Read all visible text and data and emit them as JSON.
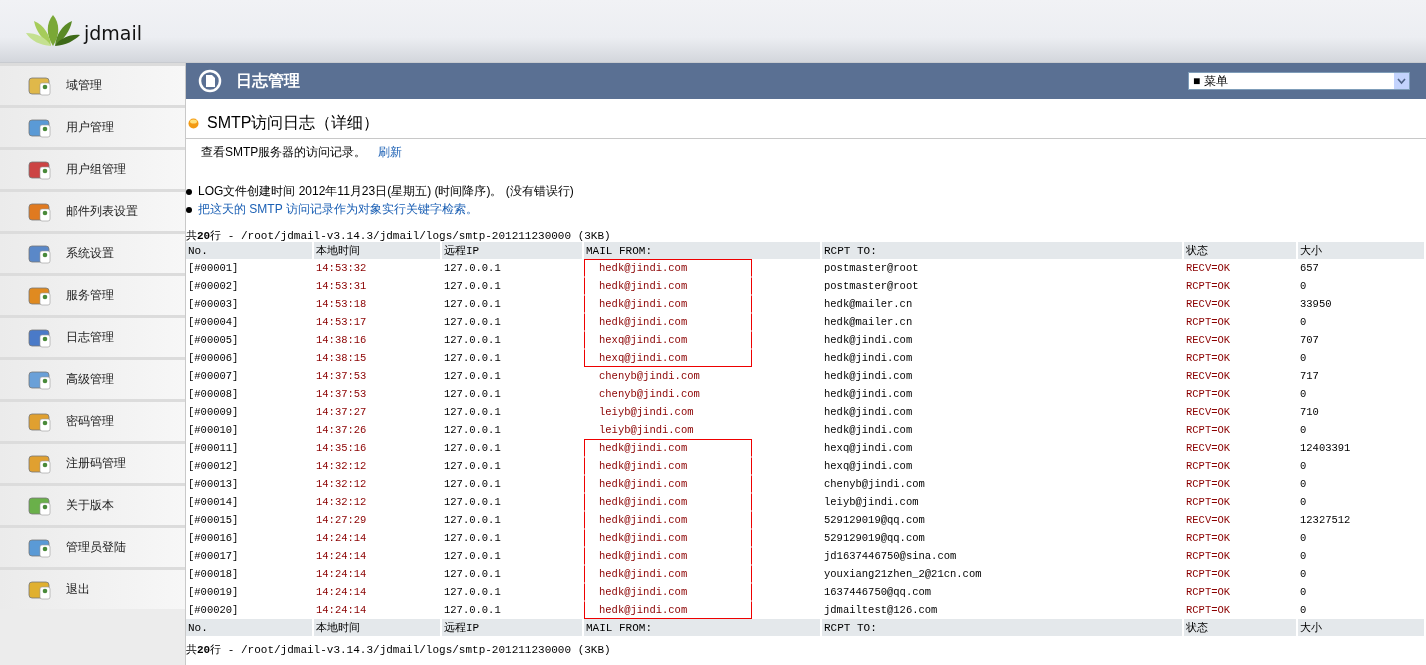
{
  "brand": {
    "name": "jdmail"
  },
  "sidebar": {
    "items": [
      {
        "label": "域管理"
      },
      {
        "label": "用户管理"
      },
      {
        "label": "用户组管理"
      },
      {
        "label": "邮件列表设置"
      },
      {
        "label": "系统设置"
      },
      {
        "label": "服务管理"
      },
      {
        "label": "日志管理"
      },
      {
        "label": "高级管理"
      },
      {
        "label": "密码管理"
      },
      {
        "label": "注册码管理"
      },
      {
        "label": "关于版本"
      },
      {
        "label": "管理员登陆"
      },
      {
        "label": "退出"
      }
    ]
  },
  "title_bar": {
    "title": "日志管理",
    "menu_select": "■ 菜单"
  },
  "section": {
    "title": "SMTP访问日志（详细）",
    "description": "查看SMTP服务器的访问记录。",
    "refresh_link": "刷新",
    "bullets": [
      {
        "kind": "text",
        "text": "LOG文件创建时间 2012年11月23日(星期五) (时间降序)。 (没有错误行)"
      },
      {
        "kind": "link",
        "text": "把这天的 SMTP 访问记录作为对象实行关键字检索。"
      }
    ]
  },
  "summary_top": "共**20**行 - /root/jdmail-v3.14.3/jdmail/logs/smtp-201211230000 (3KB)",
  "table": {
    "columns": [
      "No.",
      "本地时间",
      "远程IP",
      "MAIL FROM:",
      "RCPT TO:",
      "状态",
      "大小"
    ],
    "rows": [
      {
        "no": "[#00001]",
        "time": "14:53:32",
        "ip": "127.0.0.1",
        "from": "hedk@jindi.com",
        "to": "postmaster@root",
        "status": "RECV=OK",
        "size": "657",
        "boxed": true
      },
      {
        "no": "[#00002]",
        "time": "14:53:31",
        "ip": "127.0.0.1",
        "from": "hedk@jindi.com",
        "to": "postmaster@root",
        "status": "RCPT=OK",
        "size": "0",
        "boxed": true
      },
      {
        "no": "[#00003]",
        "time": "14:53:18",
        "ip": "127.0.0.1",
        "from": "hedk@jindi.com",
        "to": "hedk@mailer.cn",
        "status": "RECV=OK",
        "size": "33950",
        "boxed": true
      },
      {
        "no": "[#00004]",
        "time": "14:53:17",
        "ip": "127.0.0.1",
        "from": "hedk@jindi.com",
        "to": "hedk@mailer.cn",
        "status": "RCPT=OK",
        "size": "0",
        "boxed": true
      },
      {
        "no": "[#00005]",
        "time": "14:38:16",
        "ip": "127.0.0.1",
        "from": "hexq@jindi.com",
        "to": "hedk@jindi.com",
        "status": "RECV=OK",
        "size": "707",
        "boxed": true
      },
      {
        "no": "[#00006]",
        "time": "14:38:15",
        "ip": "127.0.0.1",
        "from": "hexq@jindi.com",
        "to": "hedk@jindi.com",
        "status": "RCPT=OK",
        "size": "0",
        "boxed": true
      },
      {
        "no": "[#00007]",
        "time": "14:37:53",
        "ip": "127.0.0.1",
        "from": "chenyb@jindi.com",
        "to": "hedk@jindi.com",
        "status": "RECV=OK",
        "size": "717",
        "boxed": false
      },
      {
        "no": "[#00008]",
        "time": "14:37:53",
        "ip": "127.0.0.1",
        "from": "chenyb@jindi.com",
        "to": "hedk@jindi.com",
        "status": "RCPT=OK",
        "size": "0",
        "boxed": false
      },
      {
        "no": "[#00009]",
        "time": "14:37:27",
        "ip": "127.0.0.1",
        "from": "leiyb@jindi.com",
        "to": "hedk@jindi.com",
        "status": "RECV=OK",
        "size": "710",
        "boxed": false
      },
      {
        "no": "[#00010]",
        "time": "14:37:26",
        "ip": "127.0.0.1",
        "from": "leiyb@jindi.com",
        "to": "hedk@jindi.com",
        "status": "RCPT=OK",
        "size": "0",
        "boxed": false
      },
      {
        "no": "[#00011]",
        "time": "14:35:16",
        "ip": "127.0.0.1",
        "from": "hedk@jindi.com",
        "to": "hexq@jindi.com",
        "status": "RECV=OK",
        "size": "12403391",
        "boxed": true
      },
      {
        "no": "[#00012]",
        "time": "14:32:12",
        "ip": "127.0.0.1",
        "from": "hedk@jindi.com",
        "to": "hexq@jindi.com",
        "status": "RCPT=OK",
        "size": "0",
        "boxed": true
      },
      {
        "no": "[#00013]",
        "time": "14:32:12",
        "ip": "127.0.0.1",
        "from": "hedk@jindi.com",
        "to": "chenyb@jindi.com",
        "status": "RCPT=OK",
        "size": "0",
        "boxed": true
      },
      {
        "no": "[#00014]",
        "time": "14:32:12",
        "ip": "127.0.0.1",
        "from": "hedk@jindi.com",
        "to": "leiyb@jindi.com",
        "status": "RCPT=OK",
        "size": "0",
        "boxed": true
      },
      {
        "no": "[#00015]",
        "time": "14:27:29",
        "ip": "127.0.0.1",
        "from": "hedk@jindi.com",
        "to": "529129019@qq.com",
        "status": "RECV=OK",
        "size": "12327512",
        "boxed": true
      },
      {
        "no": "[#00016]",
        "time": "14:24:14",
        "ip": "127.0.0.1",
        "from": "hedk@jindi.com",
        "to": "529129019@qq.com",
        "status": "RCPT=OK",
        "size": "0",
        "boxed": true
      },
      {
        "no": "[#00017]",
        "time": "14:24:14",
        "ip": "127.0.0.1",
        "from": "hedk@jindi.com",
        "to": "jd1637446750@sina.com",
        "status": "RCPT=OK",
        "size": "0",
        "boxed": true
      },
      {
        "no": "[#00018]",
        "time": "14:24:14",
        "ip": "127.0.0.1",
        "from": "hedk@jindi.com",
        "to": "youxiang21zhen_2@21cn.com",
        "status": "RCPT=OK",
        "size": "0",
        "boxed": true
      },
      {
        "no": "[#00019]",
        "time": "14:24:14",
        "ip": "127.0.0.1",
        "from": "hedk@jindi.com",
        "to": "1637446750@qq.com",
        "status": "RCPT=OK",
        "size": "0",
        "boxed": true
      },
      {
        "no": "[#00020]",
        "time": "14:24:14",
        "ip": "127.0.0.1",
        "from": "hedk@jindi.com",
        "to": "jdmailtest@126.com",
        "status": "RCPT=OK",
        "size": "0",
        "boxed": true
      }
    ],
    "footer_columns": [
      "No.",
      "本地时间",
      "远程IP",
      "MAIL FROM:",
      "RCPT TO:",
      "状态",
      "大小"
    ]
  },
  "summary_bottom": "共**20**行 - /root/jdmail-v3.14.3/jdmail/logs/smtp-201211230000 (3KB)"
}
